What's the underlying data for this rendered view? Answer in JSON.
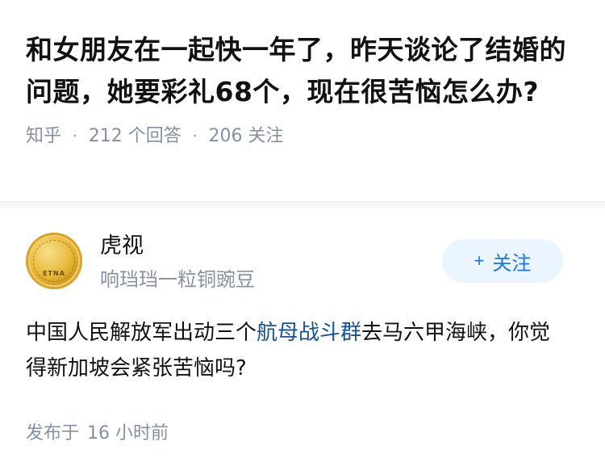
{
  "question": {
    "title": "和女朋友在一起快一年了，昨天谈论了结婚的问题，她要彩礼68个，现在很苦恼怎么办?",
    "source": "知乎",
    "answers_count": "212 个回答",
    "followers_count": "206 关注",
    "separator": "·"
  },
  "author": {
    "name": "虎视",
    "bio": "响珰珰一粒铜豌豆",
    "avatar_text": "ETNA",
    "follow_plus": "+",
    "follow_label": "关注"
  },
  "answer": {
    "text_before": "中国人民解放军出动三个",
    "link_text": "航母战斗群",
    "text_after": "去马六甲海峡，你觉得新加坡会紧张苦恼吗?"
  },
  "published": {
    "label": "发布于",
    "time": "16 小时前"
  },
  "colors": {
    "accent": "#1772f6",
    "link": "#175199",
    "meta": "#8590a6",
    "follow_bg": "#ebf5ff"
  }
}
